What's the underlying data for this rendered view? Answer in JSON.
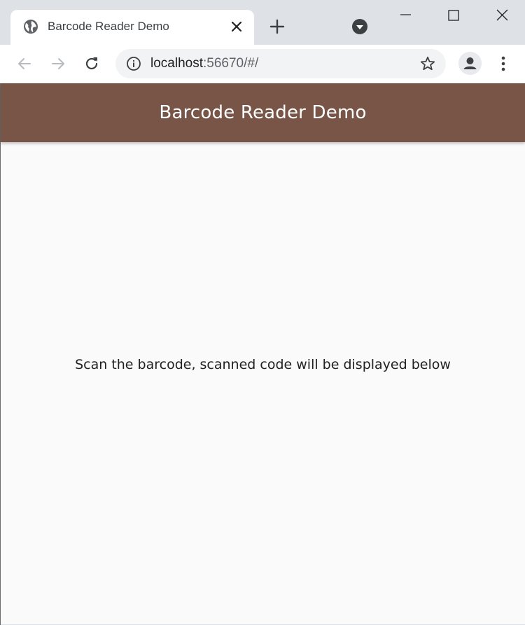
{
  "browser": {
    "tab": {
      "title": "Barcode Reader Demo",
      "favicon": "globe-icon",
      "close_icon": "close-icon"
    },
    "new_tab_icon": "plus-icon",
    "tab_search_icon": "chevron-down-circle-icon",
    "window_controls": [
      "minimize-icon",
      "maximize-icon",
      "close-icon"
    ],
    "toolbar": {
      "back_icon": "arrow-left-icon",
      "forward_icon": "arrow-right-icon",
      "reload_icon": "reload-icon",
      "address": {
        "host": "localhost",
        "rest": ":56670/#/"
      },
      "site_info_icon": "info-icon",
      "bookmark_icon": "star-icon",
      "profile_icon": "person-icon",
      "menu_icon": "more-vert-icon"
    }
  },
  "app": {
    "appbar": {
      "title": "Barcode Reader Demo",
      "color": "#795548"
    },
    "body": {
      "message": "Scan the barcode, scanned code will be displayed below"
    },
    "background": "#fafafa"
  }
}
